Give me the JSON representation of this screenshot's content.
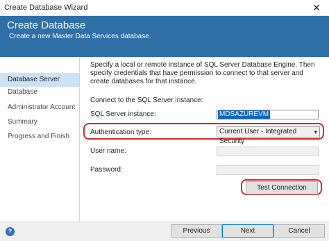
{
  "window": {
    "title": "Create Database Wizard",
    "close_glyph": "✕"
  },
  "banner": {
    "heading": "Create Database",
    "subtitle": "Create a new Master Data Services database."
  },
  "sidebar": {
    "items": [
      {
        "label": "Database Server",
        "active": true
      },
      {
        "label": "Database",
        "active": false
      },
      {
        "label": "Administrator Account",
        "active": false
      },
      {
        "label": "Summary",
        "active": false
      },
      {
        "label": "Progress and Finish",
        "active": false
      }
    ]
  },
  "main": {
    "description": "Specify a local or remote instance of SQL Server Database Engine. Then specify credentials that have permission to connect to that server and create databases for that instance.",
    "connect_heading": "Connect to the SQL Server instance:",
    "sql_instance_label": "SQL Server instance:",
    "sql_instance_value": "MDSAZUREVM",
    "auth_type_label": "Authentication type:",
    "auth_type_value": "Current User - Integrated Security",
    "username_label": "User name:",
    "password_label": "Password:",
    "test_connection_label": "Test Connection"
  },
  "footer": {
    "help_glyph": "?",
    "previous_label": "Previous",
    "next_label": "Next",
    "cancel_label": "Cancel"
  },
  "colors": {
    "banner": "#2f6fa8",
    "highlight": "#d6262c",
    "nav_active": "#cde3f5"
  }
}
